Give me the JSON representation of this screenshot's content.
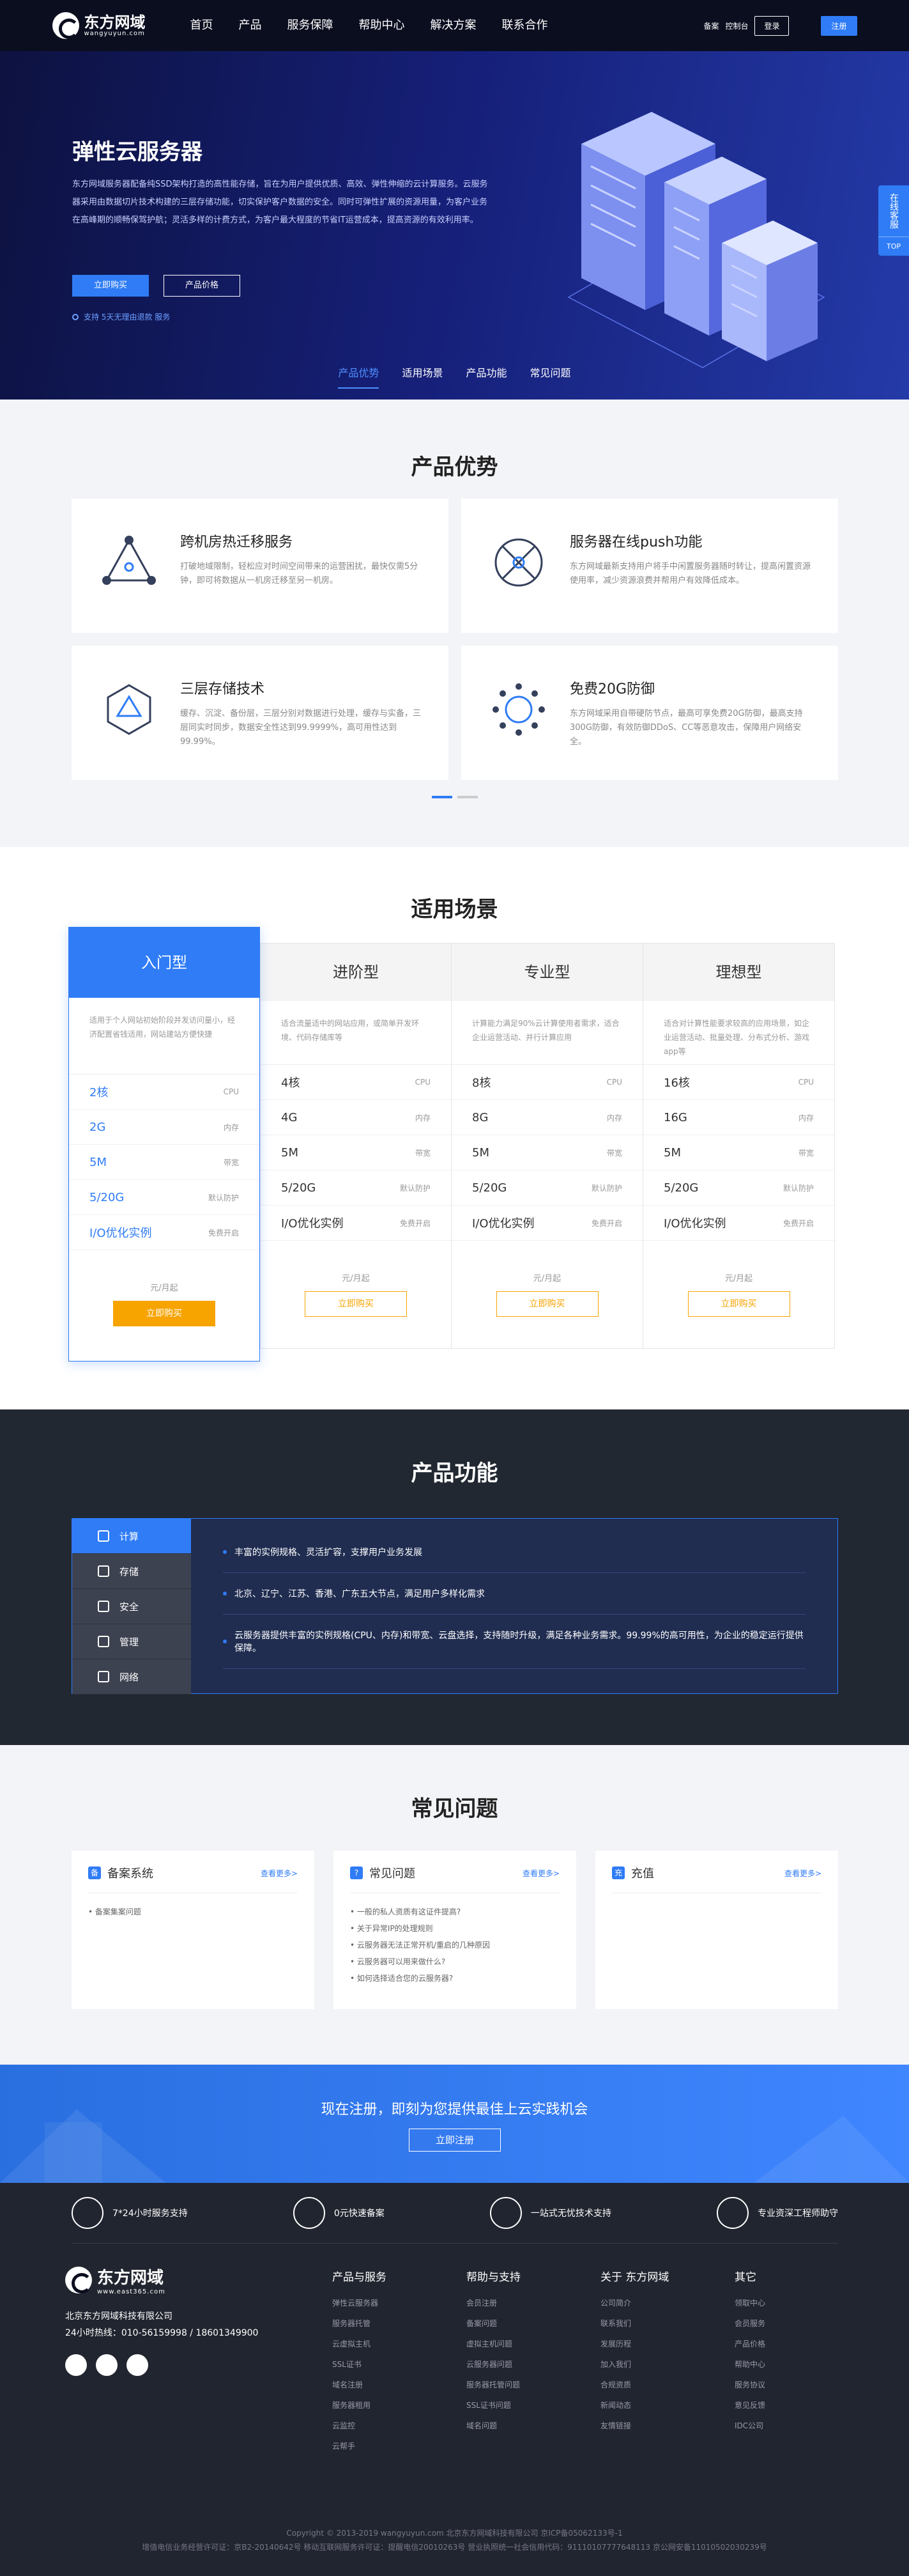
{
  "header": {
    "logo_text": "东方网域",
    "logo_sub": "wangyuyun.com",
    "nav": [
      "首页",
      "产品",
      "服务保障",
      "帮助中心",
      "解决方案",
      "联系合作"
    ],
    "links": [
      "备案",
      "控制台"
    ],
    "login": "登录",
    "register": "注册"
  },
  "hero": {
    "title": "弹性云服务器",
    "desc": "东方网域服务器配备纯SSD架构打造的高性能存储，旨在为用户提供优质、高效、弹性伸缩的云计算服务。云服务器采用由数据切片技术构建的三层存储功能，切实保护客户数据的安全。同时可弹性扩展的资源用量，为客户业务在高峰期的顺畅保驾护航；灵活多样的计费方式，为客户最大程度的节省IT运营成本，提高资源的有效利用率。",
    "btn_buy": "立即购买",
    "btn_price": "产品价格",
    "note": "支持 5天无理由退款 服务",
    "tabs": [
      "产品优势",
      "适用场景",
      "产品功能",
      "常见问题"
    ],
    "float_label": "在线客服",
    "float_top": "TOP"
  },
  "advantages": {
    "title": "产品优势",
    "items": [
      {
        "title": "跨机房热迁移服务",
        "desc": "打破地域限制，轻松应对时间空间带来的运营困扰，最快仅需5分钟，即可将数据从一机房迁移至另一机房。",
        "icon": "triangle-network-icon"
      },
      {
        "title": "服务器在线push功能",
        "desc": "东方网域最新支持用户将手中闲置服务器随时转让，提高闲置资源使用率，减少资源浪费并帮用户有效降低成本。",
        "icon": "circle-x-network-icon"
      },
      {
        "title": "三层存储技术",
        "desc": "缓存、沉淀、备份层，三层分别对数据进行处理，缓存与实备，三层同实时同步，数据安全性达到99.9999%，高可用性达到99.99%。",
        "icon": "hexagon-network-icon"
      },
      {
        "title": "免费20G防御",
        "desc": "东方网域采用自带硬防节点，最高可享免费20G防御，最高支持300G防御，有效防御DDoS、CC等恶意攻击，保障用户网络安全。",
        "icon": "ring-dots-icon"
      }
    ]
  },
  "scenarios": {
    "title": "适用场景",
    "plans": [
      {
        "name": "入门型",
        "desc": "适用于个人网站初始阶段并发访问量小，经济配置省钱适用，网站建站方便快捷",
        "specs": [
          [
            "2核",
            "CPU"
          ],
          [
            "2G",
            "内存"
          ],
          [
            "5M",
            "带宽"
          ],
          [
            "5/20G",
            "默认防护"
          ],
          [
            "I/O优化实例",
            "免费开启"
          ]
        ],
        "price": "元/月起",
        "buy": "立即购买"
      },
      {
        "name": "进阶型",
        "desc": "适合流量适中的网站应用，或简单开发环境、代码存储库等",
        "specs": [
          [
            "4核",
            "CPU"
          ],
          [
            "4G",
            "内存"
          ],
          [
            "5M",
            "带宽"
          ],
          [
            "5/20G",
            "默认防护"
          ],
          [
            "I/O优化实例",
            "免费开启"
          ]
        ],
        "price": "元/月起",
        "buy": "立即购买"
      },
      {
        "name": "专业型",
        "desc": "计算能力满足90%云计算使用者需求，适合企业运营活动、并行计算应用",
        "specs": [
          [
            "8核",
            "CPU"
          ],
          [
            "8G",
            "内存"
          ],
          [
            "5M",
            "带宽"
          ],
          [
            "5/20G",
            "默认防护"
          ],
          [
            "I/O优化实例",
            "免费开启"
          ]
        ],
        "price": "元/月起",
        "buy": "立即购买"
      },
      {
        "name": "理想型",
        "desc": "适合对计算性能要求较高的应用场景，如企业运营活动、批量处理、分布式分析、游戏app等",
        "specs": [
          [
            "16核",
            "CPU"
          ],
          [
            "16G",
            "内存"
          ],
          [
            "5M",
            "带宽"
          ],
          [
            "5/20G",
            "默认防护"
          ],
          [
            "I/O优化实例",
            "免费开启"
          ]
        ],
        "price": "元/月起",
        "buy": "立即购买"
      }
    ]
  },
  "functions": {
    "title": "产品功能",
    "tabs": [
      "计算",
      "存储",
      "安全",
      "管理",
      "网络"
    ],
    "items": [
      "丰富的实例规格、灵活扩容，支撑用户业务发展",
      "北京、辽宁、江苏、香港、广东五大节点，满足用户多样化需求",
      "云服务器提供丰富的实例规格(CPU、内存)和带宽、云盘选择，支持随时升级，满足各种业务需求。99.99%的高可用性，为企业的稳定运行提供保障。"
    ]
  },
  "faq": {
    "title": "常见问题",
    "more": "查看更多>",
    "cards": [
      {
        "title": "备案系统",
        "icon_label": "备",
        "items": [
          "备案集案问题"
        ]
      },
      {
        "title": "常见问题",
        "icon_label": "?",
        "items": [
          "一般的私人资质有这证件提高?",
          "关于异常IP的处理规则",
          "云服务器无法正常开机/重启的几种原因",
          "云服务器可以用来做什么?",
          "如何选择适合您的云服务器?"
        ]
      },
      {
        "title": "充值",
        "icon_label": "充",
        "items": []
      }
    ]
  },
  "cta": {
    "text": "现在注册，即刻为您提供最佳上云实践机会",
    "button": "立即注册"
  },
  "footer": {
    "services": [
      "7*24小时服务支持",
      "0元快速备案",
      "一站式无忧技术支持",
      "专业资深工程师助守"
    ],
    "logo": "东方网域",
    "logo_sub": "www.east365.com",
    "company": "北京东方网域科技有限公司",
    "tel": "24小时热线：010-56159998 / 18601349900",
    "columns": [
      {
        "title": "产品与服务",
        "items": [
          "弹性云服务器",
          "服务器托管",
          "云虚拟主机",
          "SSL证书",
          "域名注册",
          "服务器租用",
          "云监控",
          "云帮手"
        ]
      },
      {
        "title": "帮助与支持",
        "items": [
          "会员注册",
          "备案问题",
          "虚拟主机问题",
          "云服务器问题",
          "服务器托管问题",
          "SSL证书问题",
          "域名问题"
        ]
      },
      {
        "title": "关于 东方网域",
        "items": [
          "公司简介",
          "联系我们",
          "发展历程",
          "加入我们",
          "合规资质",
          "新闻动态",
          "友情链接"
        ]
      },
      {
        "title": "其它",
        "items": [
          "领取中心",
          "会员服务",
          "产品价格",
          "帮助中心",
          "服务协议",
          "意见反馈",
          "IDC公司"
        ]
      }
    ],
    "copyright": "Copyright © 2013-2019 wangyuyun.com  北京东方网域科技有限公司  京ICP备05062133号-1",
    "license": "增值电信业务经营许可证：京B2-20140642号  移动互联网服务许可证：提醒电信20010263号  营业执照统一社会信用代码：91110107777648113  京公网安备11010502030239号"
  }
}
